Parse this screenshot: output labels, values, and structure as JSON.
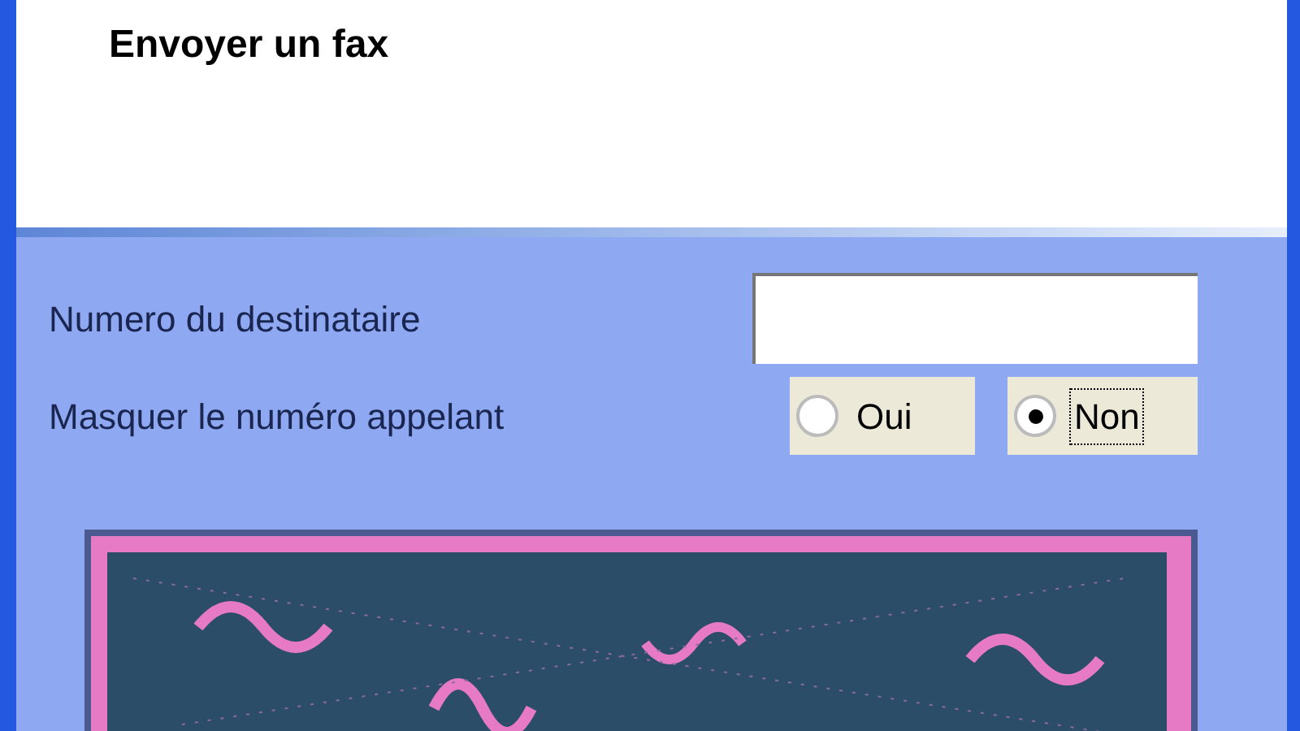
{
  "header": {
    "title": "Envoyer un fax"
  },
  "recipient": {
    "label": "Numero du destinataire"
  },
  "hide_caller": {
    "label": "Masquer le numéro appelant",
    "options": [
      {
        "label": "Oui",
        "selected": false
      },
      {
        "label": "Non",
        "selected": true
      }
    ]
  }
}
